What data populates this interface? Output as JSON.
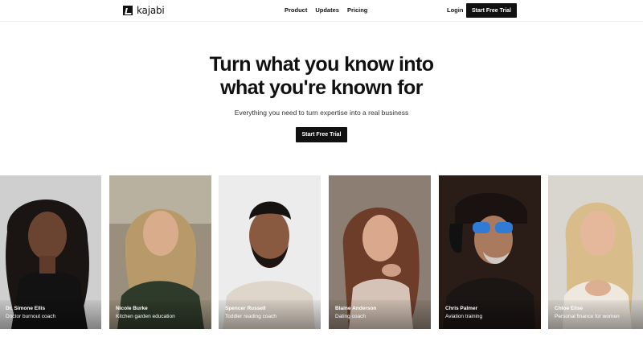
{
  "header": {
    "brand": "kajabi",
    "nav": [
      "Product",
      "Updates",
      "Pricing"
    ],
    "login": "Login",
    "cta": "Start Free Trial"
  },
  "hero": {
    "title_line1": "Turn what you know into",
    "title_line2": "what you're known for",
    "subtitle": "Everything you need to turn expertise into a real business",
    "cta": "Start Free Trial"
  },
  "creators": [
    {
      "name": "Dr. Simone Ellis",
      "role": "Doctor burnout coach"
    },
    {
      "name": "Nicole Burke",
      "role": "Kitchen garden education"
    },
    {
      "name": "Spencer Russell",
      "role": "Toddler reading coach"
    },
    {
      "name": "Blaine Anderson",
      "role": "Dating coach"
    },
    {
      "name": "Chris Palmer",
      "role": "Aviation training"
    },
    {
      "name": "Chloe Elise",
      "role": "Personal finance for women"
    }
  ],
  "colors": {
    "accent": "#111111",
    "background": "#ffffff"
  }
}
